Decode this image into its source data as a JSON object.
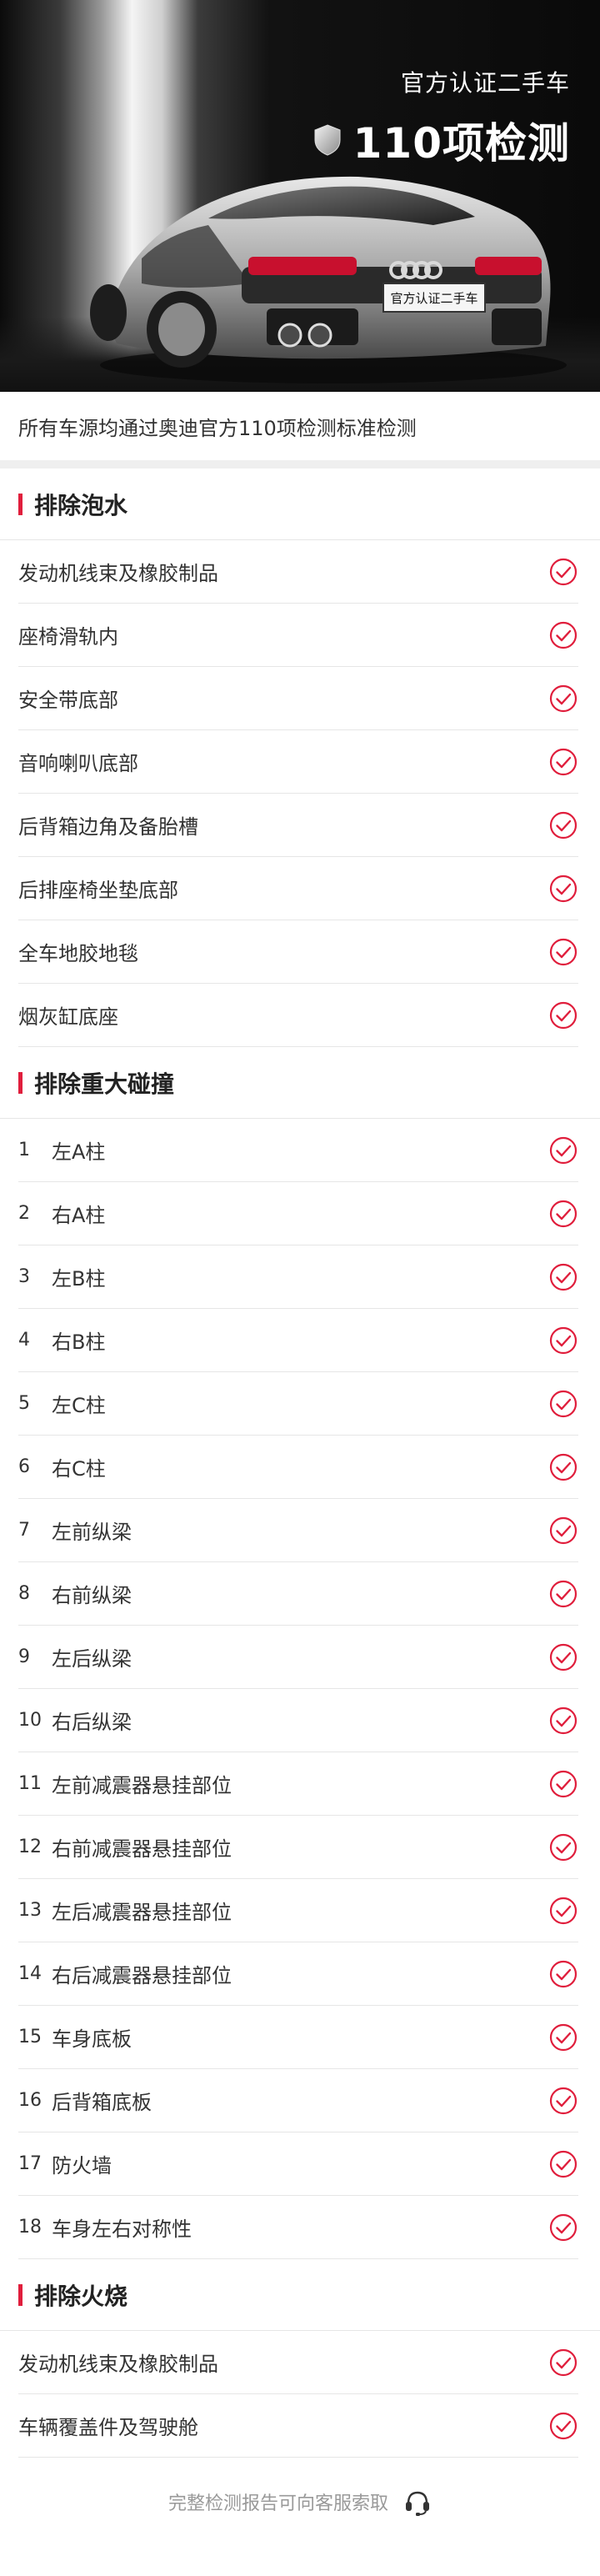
{
  "hero": {
    "subtitle": "官方认证二手车",
    "title": "110项检测",
    "plate_text": "官方认证二手车",
    "icons": [
      "shield-icon"
    ]
  },
  "intro": {
    "text": "所有车源均通过奥迪官方110项检测标准检测"
  },
  "colors": {
    "accent": "#e01e3c",
    "divider": "#e6e6e6",
    "muted": "#999999"
  },
  "sections": [
    {
      "title": "排除泡水",
      "items": [
        {
          "label": "发动机线束及橡胶制品"
        },
        {
          "label": "座椅滑轨内"
        },
        {
          "label": "安全带底部"
        },
        {
          "label": "音响喇叭底部"
        },
        {
          "label": "后背箱边角及备胎槽"
        },
        {
          "label": "后排座椅坐垫底部"
        },
        {
          "label": "全车地胶地毯"
        },
        {
          "label": "烟灰缸底座"
        }
      ]
    },
    {
      "title": "排除重大碰撞",
      "items": [
        {
          "num": "1",
          "label": "左A柱"
        },
        {
          "num": "2",
          "label": "右A柱"
        },
        {
          "num": "3",
          "label": "左B柱"
        },
        {
          "num": "4",
          "label": "右B柱"
        },
        {
          "num": "5",
          "label": "左C柱"
        },
        {
          "num": "6",
          "label": "右C柱"
        },
        {
          "num": "7",
          "label": "左前纵梁"
        },
        {
          "num": "8",
          "label": "右前纵梁"
        },
        {
          "num": "9",
          "label": "左后纵梁"
        },
        {
          "num": "10",
          "label": "右后纵梁"
        },
        {
          "num": "11",
          "label": "左前减震器悬挂部位"
        },
        {
          "num": "12",
          "label": "右前减震器悬挂部位"
        },
        {
          "num": "13",
          "label": "左后减震器悬挂部位"
        },
        {
          "num": "14",
          "label": "右后减震器悬挂部位"
        },
        {
          "num": "15",
          "label": "车身底板"
        },
        {
          "num": "16",
          "label": "后背箱底板"
        },
        {
          "num": "17",
          "label": "防火墙"
        },
        {
          "num": "18",
          "label": "车身左右对称性"
        }
      ]
    },
    {
      "title": "排除火烧",
      "items": [
        {
          "label": "发动机线束及橡胶制品"
        },
        {
          "label": "车辆覆盖件及驾驶舱"
        }
      ]
    }
  ],
  "footer": {
    "text": "完整检测报告可向客服索取",
    "icon": "headset-icon"
  }
}
